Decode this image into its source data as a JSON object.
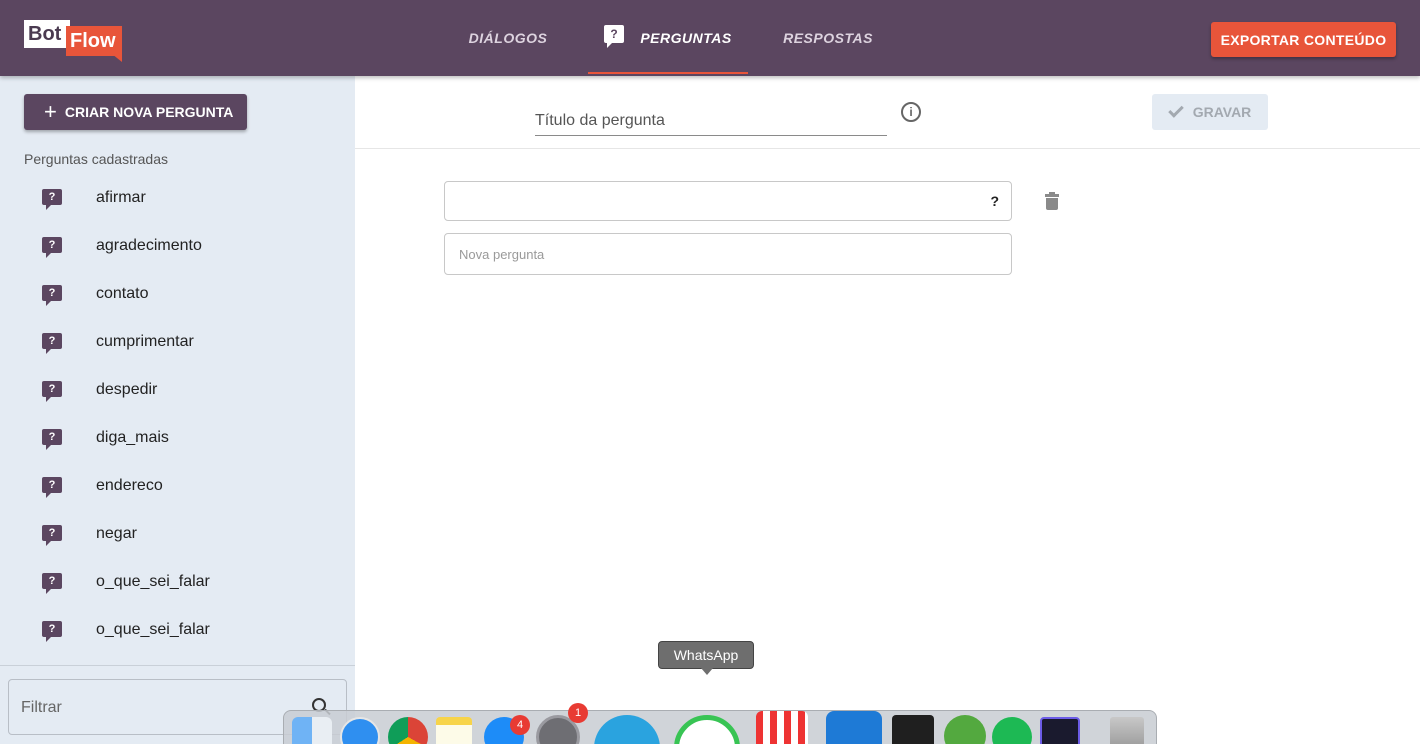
{
  "header": {
    "logo_bot": "Bot",
    "logo_flow": "Flow",
    "nav": {
      "dialogos": "DIÁLOGOS",
      "perguntas": "PERGUNTAS",
      "respostas": "RESPOSTAS"
    },
    "export_label": "EXPORTAR CONTEÚDO"
  },
  "sidebar": {
    "new_button_label": "CRIAR NOVA PERGUNTA",
    "section_label": "Perguntas cadastradas",
    "items": [
      "afirmar",
      "agradecimento",
      "contato",
      "cumprimentar",
      "despedir",
      "diga_mais",
      "endereco",
      "negar",
      "o_que_sei_falar",
      "o_que_sei_falar"
    ],
    "filter_placeholder": "Filtrar"
  },
  "main": {
    "title_placeholder": "Título da pergunta",
    "info_icon": "i",
    "save_label": "GRAVAR",
    "question_value": "",
    "question_mark": "?",
    "new_question_placeholder": "Nova pergunta"
  },
  "dock": {
    "tooltip": "WhatsApp",
    "badges": {
      "appstore": "4",
      "settings": "1"
    }
  },
  "colors": {
    "header": "#5b4660",
    "accent": "#e8553a",
    "sidebar": "#e4ebf3"
  }
}
